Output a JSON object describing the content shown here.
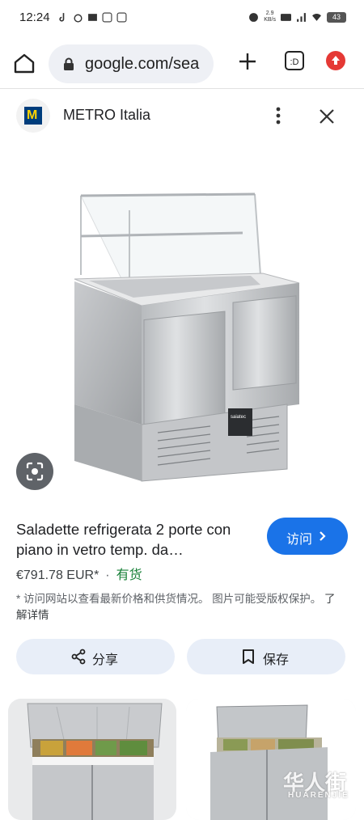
{
  "status_bar": {
    "time": "12:24",
    "net_speed": "2.9\nKB/s",
    "battery": "43"
  },
  "browser": {
    "url": "google.com/sea",
    "tab_count": ":D"
  },
  "source": {
    "name": "METRO Italia",
    "logo_letter": "M"
  },
  "product": {
    "title": "Saladette refrigerata 2 porte con piano in vetro temp. da…",
    "price": "€791.78 EUR*",
    "availability": "有货",
    "visit_label": "访问",
    "disclaimer": "* 访问网站以查看最新价格和供货情况。 图片可能受版权保护。",
    "learn_more": "了解详情",
    "brand_on_unit": "saiatec"
  },
  "actions": {
    "share_label": "分享",
    "save_label": "保存"
  },
  "watermark": {
    "text": "华人街",
    "sub": "HUARENJIE"
  },
  "colors": {
    "accent": "#1a73e8",
    "stock": "#188038",
    "button_bg": "#e8eef8"
  }
}
